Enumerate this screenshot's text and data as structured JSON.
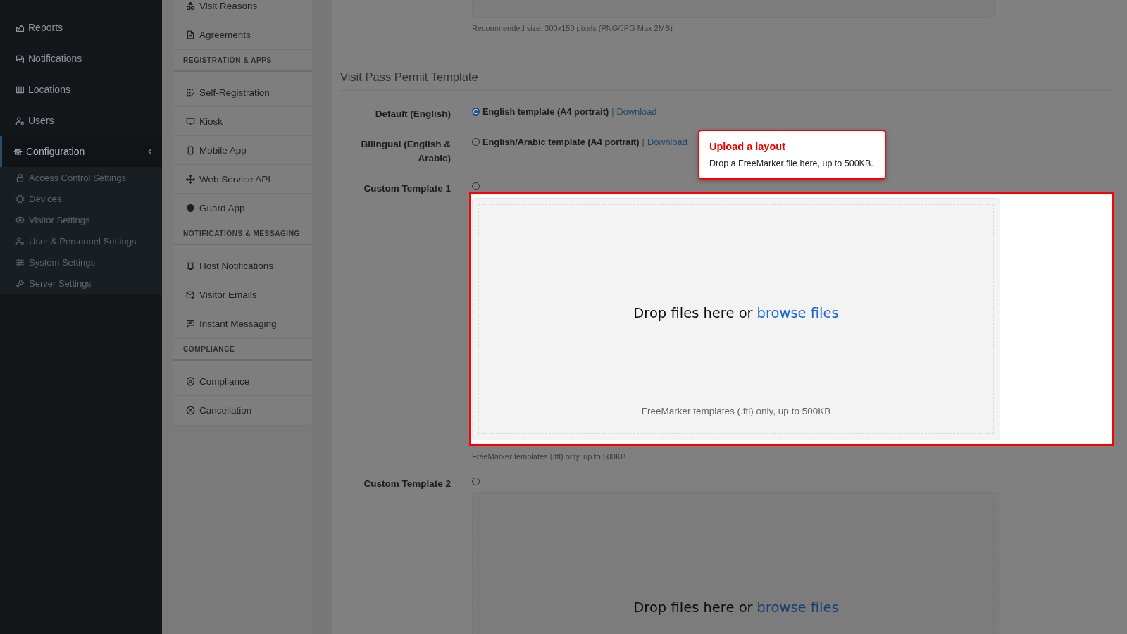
{
  "sidebar": {
    "items": [
      {
        "label": "Reports",
        "selected": false
      },
      {
        "label": "Notifications",
        "selected": false
      },
      {
        "label": "Locations",
        "selected": false
      },
      {
        "label": "Users",
        "selected": false
      },
      {
        "label": "Configuration",
        "selected": true,
        "expanded": true,
        "children": [
          {
            "label": "Access Control Settings"
          },
          {
            "label": "Devices"
          },
          {
            "label": "Visitor Settings"
          },
          {
            "label": "User & Personnel Settings"
          },
          {
            "label": "System Settings"
          },
          {
            "label": "Server Settings"
          }
        ]
      }
    ]
  },
  "settings_menu": {
    "sections": [
      {
        "items": [
          "Visit Reasons",
          "Agreements"
        ]
      },
      {
        "title": "REGISTRATION & APPS",
        "items": [
          "Self-Registration",
          "Kiosk",
          "Mobile App",
          "Web Service API",
          "Guard App"
        ]
      },
      {
        "title": "NOTIFICATIONS & MESSAGING",
        "items": [
          "Host Notifications",
          "Visitor Emails",
          "Instant Messaging"
        ]
      },
      {
        "title": "COMPLIANCE",
        "items": [
          "Compliance",
          "Cancellation"
        ]
      }
    ]
  },
  "logo_upload": {
    "hint": "Recommended size: 300x150 pixels (PNG/JPG Max 2MB)"
  },
  "template": {
    "title": "Visit Pass Permit Template",
    "options": [
      {
        "kind": "builtin",
        "label": "Default (English)",
        "selected": true,
        "option": "English template (A4 portrait)",
        "separator": "|",
        "link": "Download"
      },
      {
        "kind": "builtin",
        "label": "Bilingual (English & Arabic)",
        "selected": false,
        "option": "English/Arabic template (A4 portrait)",
        "separator": "|",
        "link": "Download"
      },
      {
        "kind": "upload",
        "label": "Custom Template 1",
        "selected": false,
        "highlighted": true,
        "drop_text": "Drop files here or",
        "browse": "browse files",
        "note": "FreeMarker templates (.ftl) only, up to 500KB",
        "hint": "FreeMarker templates (.ftl) only, up to 500KB"
      },
      {
        "kind": "upload",
        "label": "Custom Template 2",
        "selected": false,
        "highlighted": false,
        "drop_text": "Drop files here or",
        "browse": "browse files"
      }
    ]
  },
  "tour_tooltip": {
    "title": "Upload a layout",
    "text": "Drop a FreeMarker file here, up to 500KB."
  }
}
